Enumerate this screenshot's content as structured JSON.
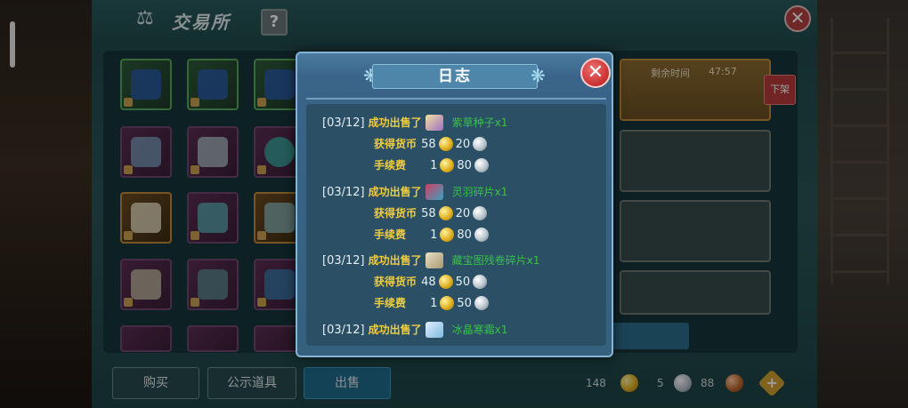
{
  "exchange": {
    "title": "交易所",
    "help_label": "?",
    "close_label": "✕",
    "remaining_label": "剩余时间",
    "remaining_time": "47:57",
    "delist_label": "下架",
    "tabs": [
      {
        "label": "购买",
        "active": false
      },
      {
        "label": "公示道具",
        "active": false
      },
      {
        "label": "出售",
        "active": true
      }
    ],
    "currency": {
      "gold": "148",
      "silver": "5",
      "copper": "88",
      "add_label": "+"
    }
  },
  "log_modal": {
    "title": "日志",
    "close_label": "✕",
    "entries": [
      {
        "date": "[03/12]",
        "sold_label": "成功出售了",
        "item_icon": "scroll-icon",
        "item_name": "紫草种子x1",
        "earned_label": "获得货币",
        "earned_gold": "58",
        "earned_silver": "20",
        "fee_label": "手续费",
        "fee_gold": "1",
        "fee_silver": "80"
      },
      {
        "date": "[03/12]",
        "sold_label": "成功出售了",
        "item_icon": "feather-icon",
        "item_name": "灵羽碎片x1",
        "earned_label": "获得货币",
        "earned_gold": "58",
        "earned_silver": "20",
        "fee_label": "手续费",
        "fee_gold": "1",
        "fee_silver": "80"
      },
      {
        "date": "[03/12]",
        "sold_label": "成功出售了",
        "item_icon": "map-icon",
        "item_name": "藏宝图残卷碎片x1",
        "earned_label": "获得货币",
        "earned_gold": "48",
        "earned_silver": "50",
        "fee_label": "手续费",
        "fee_gold": "1",
        "fee_silver": "50"
      },
      {
        "date": "[03/12]",
        "sold_label": "成功出售了",
        "item_icon": "crystal-icon",
        "item_name": "冰晶寒霜x1"
      }
    ]
  },
  "colors": {
    "accent_gold": "#f0cc40",
    "item_green": "#38c048",
    "modal_blue": "#3a6488",
    "close_red": "#c83030"
  }
}
